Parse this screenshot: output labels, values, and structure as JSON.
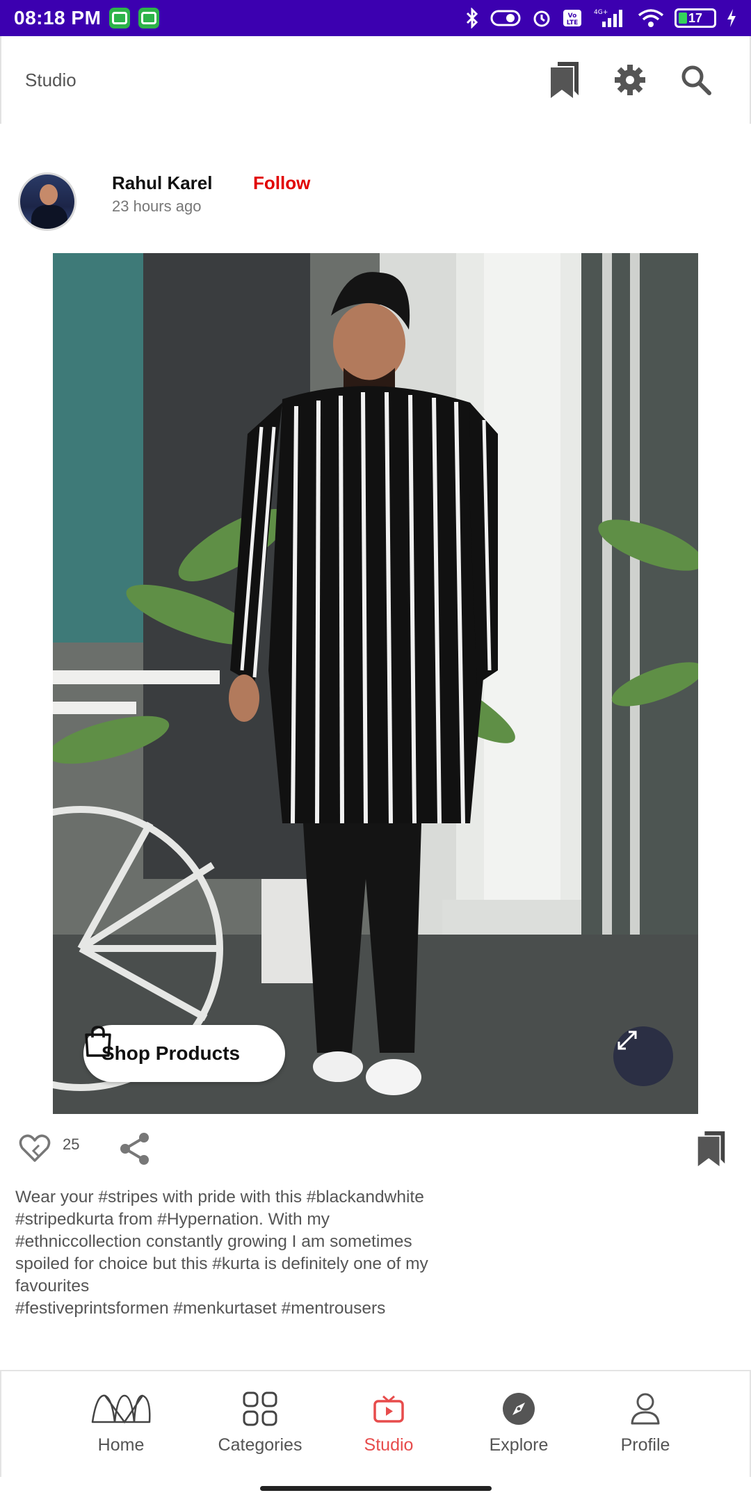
{
  "status_bar": {
    "time": "08:18 PM",
    "battery": "17",
    "network": "4G+",
    "volte": "Vo LTE"
  },
  "header": {
    "title": "Studio"
  },
  "post": {
    "author_name": "Rahul Karel",
    "follow_label": "Follow",
    "timestamp": "23 hours ago",
    "shop_label": "Shop Products",
    "likes": "25",
    "caption_lines": [
      "Wear your #stripes with pride with this #blackandwhite",
      "#stripedkurta from #Hypernation. With my",
      "#ethniccollection constantly growing I am sometimes",
      "spoiled for choice but this #kurta is definitely one of my",
      "favourites",
      "#festiveprintsformen #menkurtaset #mentrousers"
    ]
  },
  "bottom_nav": {
    "items": [
      {
        "label": "Home",
        "icon": "myntra-logo-icon"
      },
      {
        "label": "Categories",
        "icon": "grid-icon"
      },
      {
        "label": "Studio",
        "icon": "tv-play-icon"
      },
      {
        "label": "Explore",
        "icon": "compass-icon"
      },
      {
        "label": "Profile",
        "icon": "person-icon"
      }
    ],
    "active": "Studio"
  },
  "colors": {
    "status_bar": "#3c00b0",
    "follow": "#e10000",
    "active_nav": "#e74c4c"
  }
}
